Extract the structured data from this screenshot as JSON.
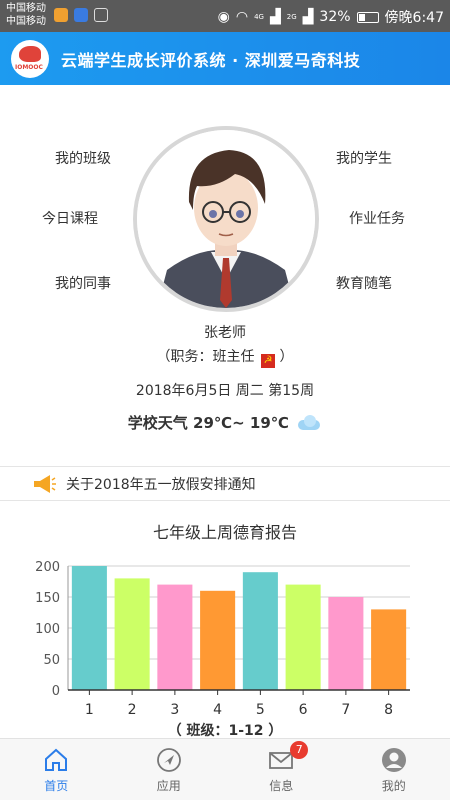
{
  "status_bar": {
    "carrier_1": "中国移动",
    "carrier_2": "中国移动",
    "signal_label_1": "4G",
    "signal_label_2": "2G",
    "battery": "32%",
    "time": "傍晚6:47",
    "icons": [
      "mail-icon",
      "baidu-icon",
      "app-icon",
      "eye-icon",
      "wifi-icon",
      "signal-icon",
      "battery-icon"
    ]
  },
  "header": {
    "title": "云端学生成长评价系统 · 深圳爱马奇科技",
    "logo_text": "IOMOOC"
  },
  "menu": {
    "left": [
      "我的班级",
      "今日课程",
      "我的同事"
    ],
    "right": [
      "我的学生",
      "作业任务",
      "教育随笔"
    ]
  },
  "profile": {
    "name": "张老师",
    "role_prefix": "（职务：班主任",
    "role_suffix": "）",
    "date": "2018年6月5日 周二 第15周",
    "weather_label": "学校天气",
    "temp_high": "29℃",
    "temp_sep": "~",
    "temp_low": "19℃"
  },
  "notice": {
    "text": "关于2018年五一放假安排通知"
  },
  "chart_data": {
    "type": "bar",
    "title": "七年级上周德育报告",
    "categories": [
      "1",
      "2",
      "3",
      "4",
      "5",
      "6",
      "7",
      "8"
    ],
    "values": [
      200,
      180,
      170,
      160,
      190,
      170,
      150,
      130
    ],
    "colors": [
      "#66cccc",
      "#ccff66",
      "#ff99cc",
      "#ff9933",
      "#66cccc",
      "#ccff66",
      "#ff99cc",
      "#ff9933"
    ],
    "yticks": [
      0,
      50,
      100,
      150,
      200
    ],
    "ylim": [
      0,
      200
    ],
    "grid": true,
    "footer": "（ 班级：1-12 ）"
  },
  "tabbar": {
    "tabs": [
      {
        "label": "首页",
        "icon": "home-icon",
        "active": true
      },
      {
        "label": "应用",
        "icon": "compass-icon",
        "active": false
      },
      {
        "label": "信息",
        "icon": "mail-icon",
        "active": false,
        "badge": "7"
      },
      {
        "label": "我的",
        "icon": "user-icon",
        "active": false
      }
    ]
  }
}
